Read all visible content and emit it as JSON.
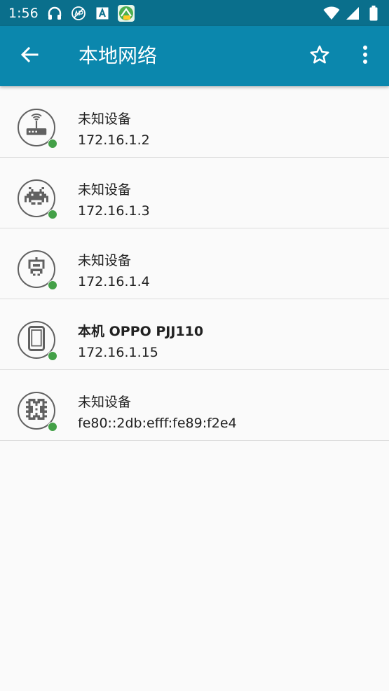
{
  "status_bar": {
    "time": "1:56",
    "icons": [
      "headphones-icon",
      "no-vpn-icon",
      "font-app-icon",
      "battery-saver-app-icon",
      "wifi-icon",
      "cellular-signal-icon",
      "battery-icon"
    ]
  },
  "app_bar": {
    "title": "本地网络",
    "back_icon": "arrow-left-icon",
    "favorite_icon": "star-outline-icon",
    "more_icon": "more-vertical-icon"
  },
  "devices": [
    {
      "name": "未知设备",
      "address": "172.16.1.2",
      "icon": "router-icon",
      "online": true
    },
    {
      "name": "未知设备",
      "address": "172.16.1.3",
      "icon": "space-invader-icon",
      "online": true
    },
    {
      "name": "未知设备",
      "address": "172.16.1.4",
      "icon": "pixel-robot-icon",
      "online": true
    },
    {
      "name": "本机 OPPO PJJ110",
      "address": "172.16.1.15",
      "icon": "smartphone-icon",
      "online": true
    },
    {
      "name": "未知设备",
      "address": "fe80::2db:efff:fe89:f2e4",
      "icon": "pixel-pattern-icon",
      "online": true
    }
  ],
  "colors": {
    "status_bar": "#0a6f8c",
    "app_bar": "#0b87ad",
    "online_dot": "#43a047",
    "icon_gray": "#616161",
    "background": "#fafafa"
  }
}
